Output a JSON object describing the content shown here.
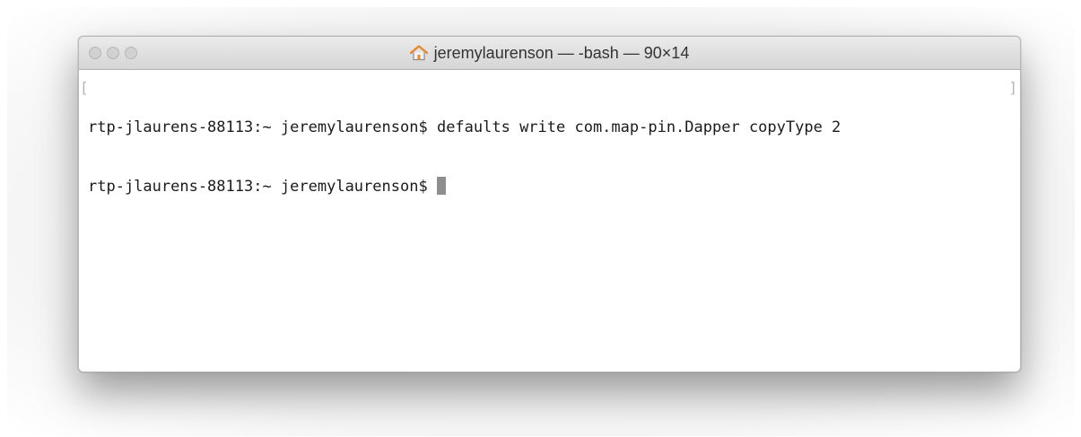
{
  "window": {
    "title": "jeremylaurenson — -bash — 90×14",
    "title_icon": "home-icon"
  },
  "terminal": {
    "lines": [
      {
        "prompt": "rtp-jlaurens-88113:~ jeremylaurenson$",
        "command": "defaults write com.map-pin.Dapper copyType 2"
      },
      {
        "prompt": "rtp-jlaurens-88113:~ jeremylaurenson$",
        "command": ""
      }
    ],
    "bracket_left": "[",
    "bracket_right": "]"
  },
  "colors": {
    "traffic_light": "#d1d1d1",
    "home_icon_roof": "#e8872a",
    "text": "#1b1b1b",
    "cursor": "#8e8e8e"
  }
}
